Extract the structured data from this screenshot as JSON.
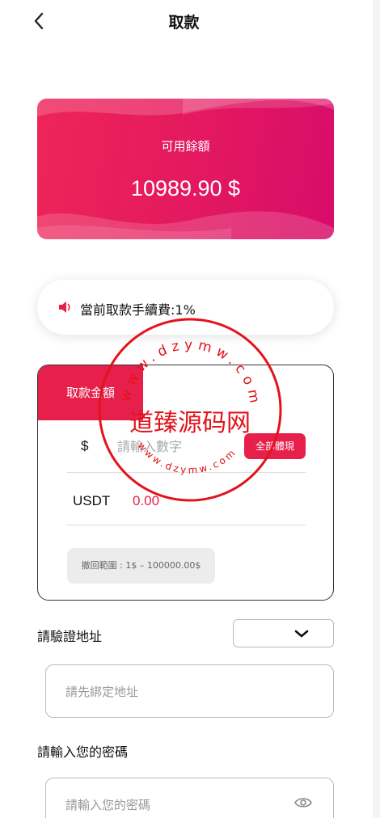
{
  "header": {
    "title": "取款",
    "back_icon": "chevron-left-icon"
  },
  "balance": {
    "label": "可用餘額",
    "value": "10989.90 $"
  },
  "fee": {
    "text": "當前取款手續費:1%",
    "icon": "speaker-icon"
  },
  "amount": {
    "tab_label": "取款金額",
    "currency_symbol": "$",
    "input_placeholder": "請輸入數字",
    "withdraw_all_label": "全部體現",
    "usdt_label": "USDT",
    "usdt_value": "0.00",
    "range_text": "撤回範圍 : 1$ – 100000.00$"
  },
  "address": {
    "label": "請驗證地址",
    "select_value": "",
    "input_placeholder": "請先綁定地址"
  },
  "password": {
    "label": "請輸入您的密碼",
    "input_placeholder": "請輸入您的密碼"
  },
  "watermark": {
    "main_text": "道臻源码网",
    "ring_text": "www.dzymw.com"
  },
  "colors": {
    "accent": "#e61f4b",
    "card_gradient_start": "#ee2558",
    "card_gradient_end": "#d80c6a",
    "watermark": "#e3131b"
  }
}
